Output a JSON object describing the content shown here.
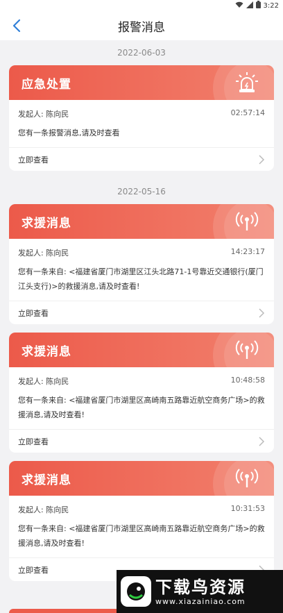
{
  "status": {
    "time": "3:22"
  },
  "header": {
    "title": "报警消息"
  },
  "groups": [
    {
      "date": "2022-06-03",
      "cards": [
        {
          "title": "应急处置",
          "icon": "alarm-light-icon",
          "sender": "发起人: 陈向民",
          "time": "02:57:14",
          "message": "您有一条报警消息,请及时查看",
          "action": "立即查看"
        }
      ]
    },
    {
      "date": "2022-05-16",
      "cards": [
        {
          "title": "求援消息",
          "icon": "broadcast-signal-icon",
          "sender": "发起人: 陈向民",
          "time": "14:23:17",
          "message": "您有一条来自: <福建省厦门市湖里区江头北路71-1号靠近交通银行(厦门江头支行)>的救援消息,请及时查看!",
          "action": "立即查看"
        },
        {
          "title": "求援消息",
          "icon": "broadcast-signal-icon",
          "sender": "发起人: 陈向民",
          "time": "10:48:58",
          "message": "您有一条来自: <福建省厦门市湖里区高崎南五路靠近航空商务广场>的救援消息,请及时查看!",
          "action": "立即查看"
        },
        {
          "title": "求援消息",
          "icon": "broadcast-signal-icon",
          "sender": "发起人: 陈向民",
          "time": "10:31:53",
          "message": "您有一条来自: <福建省厦门市湖里区高崎南五路靠近航空商务广场>的救援消息,请及时查看!",
          "action": "立即查看"
        }
      ]
    }
  ],
  "watermark": {
    "main": "下载鸟资源",
    "sub": "www.xiazainiao.com"
  }
}
